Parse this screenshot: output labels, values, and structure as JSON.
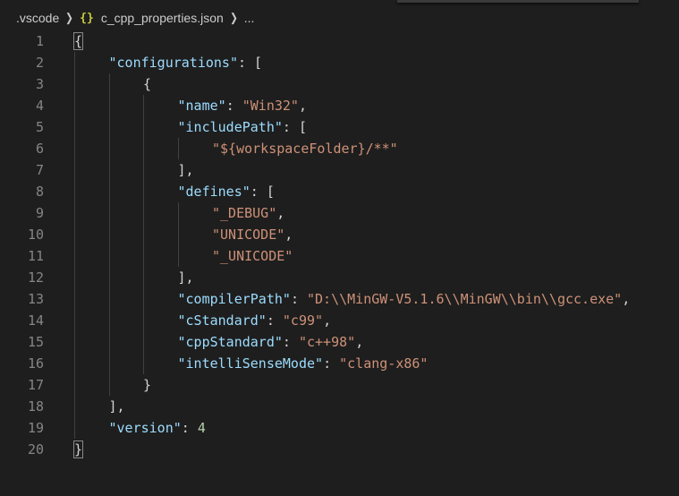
{
  "breadcrumb": {
    "folder": ".vscode",
    "icon": "{}",
    "file": "c_cpp_properties.json",
    "ellipsis": "..."
  },
  "lines": [
    {
      "num": "1",
      "indent": 0,
      "tokens": [
        {
          "t": "p",
          "v": "{"
        }
      ]
    },
    {
      "num": "2",
      "indent": 1,
      "tokens": [
        {
          "t": "k",
          "v": "\"configurations\""
        },
        {
          "t": "p",
          "v": ": ["
        }
      ]
    },
    {
      "num": "3",
      "indent": 2,
      "tokens": [
        {
          "t": "p",
          "v": "{"
        }
      ]
    },
    {
      "num": "4",
      "indent": 3,
      "tokens": [
        {
          "t": "k",
          "v": "\"name\""
        },
        {
          "t": "p",
          "v": ": "
        },
        {
          "t": "s",
          "v": "\"Win32\""
        },
        {
          "t": "p",
          "v": ","
        }
      ]
    },
    {
      "num": "5",
      "indent": 3,
      "tokens": [
        {
          "t": "k",
          "v": "\"includePath\""
        },
        {
          "t": "p",
          "v": ": ["
        }
      ]
    },
    {
      "num": "6",
      "indent": 4,
      "tokens": [
        {
          "t": "s",
          "v": "\"${workspaceFolder}/**\""
        }
      ]
    },
    {
      "num": "7",
      "indent": 3,
      "tokens": [
        {
          "t": "p",
          "v": "],"
        }
      ]
    },
    {
      "num": "8",
      "indent": 3,
      "tokens": [
        {
          "t": "k",
          "v": "\"defines\""
        },
        {
          "t": "p",
          "v": ": ["
        }
      ]
    },
    {
      "num": "9",
      "indent": 4,
      "tokens": [
        {
          "t": "s",
          "v": "\"_DEBUG\""
        },
        {
          "t": "p",
          "v": ","
        }
      ]
    },
    {
      "num": "10",
      "indent": 4,
      "tokens": [
        {
          "t": "s",
          "v": "\"UNICODE\""
        },
        {
          "t": "p",
          "v": ","
        }
      ]
    },
    {
      "num": "11",
      "indent": 4,
      "tokens": [
        {
          "t": "s",
          "v": "\"_UNICODE\""
        }
      ]
    },
    {
      "num": "12",
      "indent": 3,
      "tokens": [
        {
          "t": "p",
          "v": "],"
        }
      ]
    },
    {
      "num": "13",
      "indent": 3,
      "tokens": [
        {
          "t": "k",
          "v": "\"compilerPath\""
        },
        {
          "t": "p",
          "v": ": "
        },
        {
          "t": "s",
          "v": "\"D:\\\\MinGW-V5.1.6\\\\MinGW\\\\bin\\\\gcc.exe\""
        },
        {
          "t": "p",
          "v": ","
        }
      ]
    },
    {
      "num": "14",
      "indent": 3,
      "tokens": [
        {
          "t": "k",
          "v": "\"cStandard\""
        },
        {
          "t": "p",
          "v": ": "
        },
        {
          "t": "s",
          "v": "\"c99\""
        },
        {
          "t": "p",
          "v": ","
        }
      ]
    },
    {
      "num": "15",
      "indent": 3,
      "tokens": [
        {
          "t": "k",
          "v": "\"cppStandard\""
        },
        {
          "t": "p",
          "v": ": "
        },
        {
          "t": "s",
          "v": "\"c++98\""
        },
        {
          "t": "p",
          "v": ","
        }
      ]
    },
    {
      "num": "16",
      "indent": 3,
      "tokens": [
        {
          "t": "k",
          "v": "\"intelliSenseMode\""
        },
        {
          "t": "p",
          "v": ": "
        },
        {
          "t": "s",
          "v": "\"clang-x86\""
        }
      ]
    },
    {
      "num": "17",
      "indent": 2,
      "tokens": [
        {
          "t": "p",
          "v": "}"
        }
      ]
    },
    {
      "num": "18",
      "indent": 1,
      "tokens": [
        {
          "t": "p",
          "v": "],"
        }
      ]
    },
    {
      "num": "19",
      "indent": 1,
      "tokens": [
        {
          "t": "k",
          "v": "\"version\""
        },
        {
          "t": "p",
          "v": ": "
        },
        {
          "t": "n",
          "v": "4"
        }
      ]
    },
    {
      "num": "20",
      "indent": 0,
      "tokens": [
        {
          "t": "p",
          "v": "}"
        }
      ]
    }
  ],
  "colors": {
    "background": "#1e1e1e",
    "key": "#9cdcfe",
    "string": "#ce9178",
    "number": "#b5cea8",
    "punctuation": "#d4d4d4",
    "line_number": "#858585",
    "json_icon": "#cbcb41"
  }
}
